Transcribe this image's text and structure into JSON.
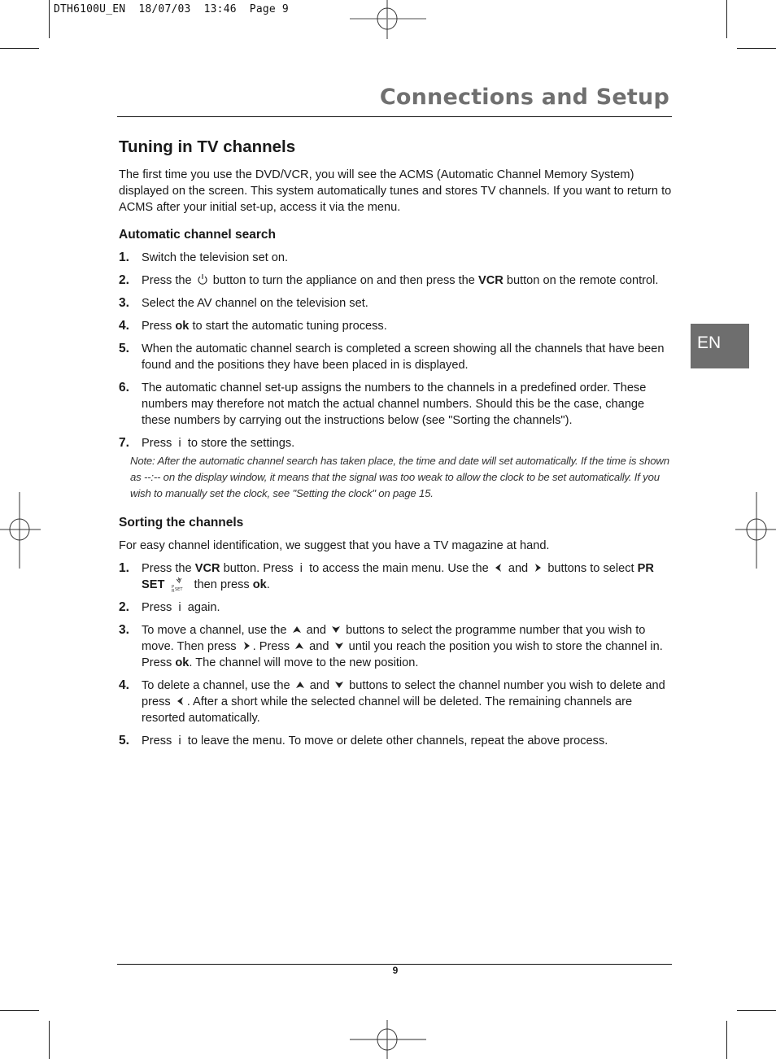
{
  "print_slug": "DTH6100U_EN  18/07/03  13:46  Page 9",
  "header": {
    "title": "Connections and Setup"
  },
  "language_tab": "EN",
  "section": {
    "title": "Tuning in TV channels",
    "intro": "The first time you use the DVD/VCR, you will see the ACMS (Automatic Channel Memory System) displayed on the screen. This system automatically tunes and stores TV channels. If you want to return to ACMS after your initial set-up, access it via the menu."
  },
  "auto_search": {
    "title": "Automatic channel search",
    "steps": [
      {
        "num": "1.",
        "text": "Switch the television set on."
      },
      {
        "num": "2.",
        "pre": "Press the",
        "icon": "power-icon",
        "mid": "button to turn the appliance on and then press the",
        "bold": "VCR",
        "post": "button on the remote control."
      },
      {
        "num": "3.",
        "text": "Select the AV channel on the television set."
      },
      {
        "num": "4.",
        "pre": "Press",
        "bold": "ok",
        "post": "to start the automatic tuning process."
      },
      {
        "num": "5.",
        "text": "When the automatic channel search is completed a screen showing all the channels that have been found and the positions they have been placed in is displayed."
      },
      {
        "num": "6.",
        "text": "The automatic channel set-up assigns the numbers to the channels in a predefined order. These numbers may therefore not match the actual channel numbers. Should this be the case, change these numbers by carrying out the instructions below (see \"Sorting the channels\")."
      },
      {
        "num": "7.",
        "pre": "Press",
        "icon": "info-icon",
        "post": "to store the settings."
      }
    ],
    "note": "Note: After the automatic channel search has taken place, the time and date will set automatically. If the time is shown as --:-- on the display window, it means that the signal was too weak to allow the clock to be set automatically. If you wish to manually set the clock, see \"Setting the clock\" on page 15."
  },
  "sorting": {
    "title": "Sorting the channels",
    "intro": "For easy channel identification, we suggest that you have a TV magazine at hand.",
    "steps": [
      {
        "num": "1.",
        "parts": [
          "Press the",
          "VCR",
          "button. Press",
          "to access the main menu. Use the",
          "and",
          "buttons to select",
          "PR SET",
          "then press",
          "ok",
          "."
        ]
      },
      {
        "num": "2.",
        "parts": [
          "Press",
          "again."
        ]
      },
      {
        "num": "3.",
        "parts": [
          "To move a channel, use the",
          "and",
          "buttons to select the programme number that you wish to move. Then press",
          ". Press",
          "and",
          "until you reach the position you wish to store the channel in. Press",
          "ok",
          ". The channel will move to the new position."
        ]
      },
      {
        "num": "4.",
        "parts": [
          "To delete a channel, use the",
          "and",
          "buttons to select the channel number you wish to delete and press",
          ". After a short while the selected channel will be deleted. The remaining channels are resorted automatically."
        ]
      },
      {
        "num": "5.",
        "parts": [
          "Press",
          "to leave the menu. To move or delete other channels, repeat the above process."
        ]
      }
    ]
  },
  "icons": {
    "info": "i",
    "prset_label": "PRSET"
  },
  "footer": {
    "page_number": "9"
  }
}
